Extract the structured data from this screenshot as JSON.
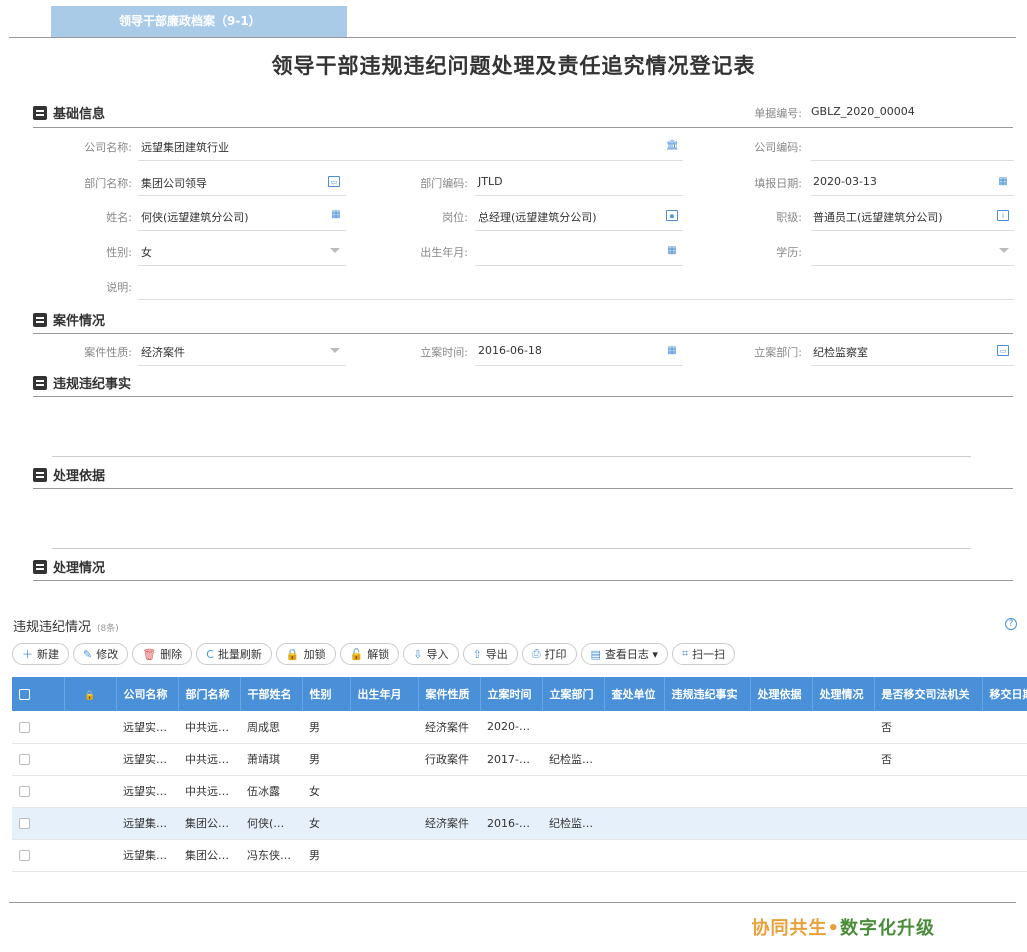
{
  "header": {
    "tab_label": "领导干部廉政档案（9-1）",
    "form_title": "领导干部违规违纪问题处理及责任追究情况登记表"
  },
  "basic": {
    "section_title": "基础信息",
    "doc_no_label": "单据编号:",
    "doc_no": "GBLZ_2020_00004",
    "company_name_label": "公司名称:",
    "company_name": "远望集团建筑行业",
    "company_code_label": "公司编码:",
    "company_code": "",
    "dept_name_label": "部门名称:",
    "dept_name": "集团公司领导",
    "dept_code_label": "部门编码:",
    "dept_code": "JTLD",
    "fill_date_label": "填报日期:",
    "fill_date": "2020-03-13",
    "name_label": "姓名:",
    "name": "何侠(远望建筑分公司)",
    "position_label": "岗位:",
    "position": "总经理(远望建筑分公司)",
    "rank_label": "职级:",
    "rank": "普通员工(远望建筑分公司)",
    "gender_label": "性别:",
    "gender": "女",
    "birth_label": "出生年月:",
    "birth": "",
    "edu_label": "学历:",
    "edu": "",
    "note_label": "说明:",
    "note": ""
  },
  "case": {
    "section_title": "案件情况",
    "nature_label": "案件性质:",
    "nature": "经济案件",
    "date_label": "立案时间:",
    "date": "2016-06-18",
    "dept_label": "立案部门:",
    "dept": "纪检监察室"
  },
  "sections": {
    "facts": "违规违纪事实",
    "basis": "处理依据",
    "handling": "处理情况"
  },
  "grid": {
    "title": "违规违纪情况",
    "count": "(8条)",
    "toolbar": [
      {
        "icon": "＋",
        "label": "新建"
      },
      {
        "icon": "✎",
        "label": "修改"
      },
      {
        "icon": "🗑",
        "label": "删除"
      },
      {
        "icon": "C",
        "label": "批量刷新"
      },
      {
        "icon": "🔒",
        "label": "加锁"
      },
      {
        "icon": "🔓",
        "label": "解锁"
      },
      {
        "icon": "⇩",
        "label": "导入"
      },
      {
        "icon": "⇧",
        "label": "导出"
      },
      {
        "icon": "⎙",
        "label": "打印"
      },
      {
        "icon": "▤",
        "label": "查看日志 ▾"
      },
      {
        "icon": "⌗",
        "label": "扫一扫"
      }
    ],
    "columns": [
      "",
      "",
      "公司名称",
      "部门名称",
      "干部姓名",
      "性别",
      "出生年月",
      "案件性质",
      "立案时间",
      "立案部门",
      "查处单位",
      "违规违纪事实",
      "处理依据",
      "处理情况",
      "是否移交司法机关",
      "移交日期"
    ],
    "rows": [
      [
        "远望实…",
        "中共远…",
        "周成思",
        "男",
        "",
        "经济案件",
        "2020-…",
        "",
        "",
        "",
        "",
        "",
        "否",
        ""
      ],
      [
        "远望实…",
        "中共远…",
        "萧靖琪",
        "男",
        "",
        "行政案件",
        "2017-…",
        "纪检监…",
        "",
        "",
        "",
        "",
        "否",
        ""
      ],
      [
        "远望实…",
        "中共远…",
        "伍冰露",
        "女",
        "",
        "",
        "",
        "",
        "",
        "",
        "",
        "",
        "",
        ""
      ],
      [
        "远望集…",
        "集团公…",
        "何侠(…",
        "女",
        "",
        "经济案件",
        "2016-…",
        "纪检监…",
        "",
        "",
        "",
        "",
        "",
        ""
      ],
      [
        "远望集…",
        "集团公…",
        "冯东侠…",
        "男",
        "",
        "",
        "",
        "",
        "",
        "",
        "",
        "",
        "",
        ""
      ]
    ],
    "selected_row": 3
  },
  "footer": {
    "slogan_a": "协同共生",
    "slogan_dot": "•",
    "slogan_b": "数字化升级",
    "color_a": "#e8a13a",
    "color_b": "#4a8c3a"
  }
}
